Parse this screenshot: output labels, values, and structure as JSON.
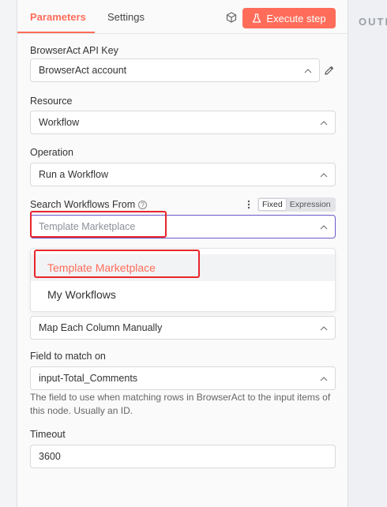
{
  "tabs": {
    "parameters": "Parameters",
    "settings": "Settings"
  },
  "execute_button": {
    "label": "Execute step"
  },
  "fields": {
    "api_key": {
      "label": "BrowserAct API Key",
      "value": "BrowserAct account"
    },
    "resource": {
      "label": "Resource",
      "value": "Workflow"
    },
    "operation": {
      "label": "Operation",
      "value": "Run a Workflow"
    },
    "search_from": {
      "label": "Search Workflows From",
      "value": "Template Marketplace",
      "mode_fixed": "Fixed",
      "mode_expression": "Expression",
      "options": [
        "Template Marketplace",
        "My Workflows"
      ]
    },
    "mapping": {
      "value": "Map Each Column Manually"
    },
    "match_field": {
      "label": "Field to match on",
      "value": "input-Total_Comments",
      "hint": "The field to use when matching rows in BrowserAct to the input items of this node. Usually an ID."
    },
    "timeout": {
      "label": "Timeout",
      "value": "3600"
    }
  },
  "output_panel": {
    "label": "OUTPU"
  },
  "colors": {
    "accent": "#ff6d5a",
    "highlight_box": "#e8262b",
    "focus_border": "#6b5ac9"
  },
  "icons": [
    "cube-icon",
    "beaker-icon",
    "pencil-icon",
    "chevron-up-icon",
    "help-icon",
    "dots-icon"
  ]
}
